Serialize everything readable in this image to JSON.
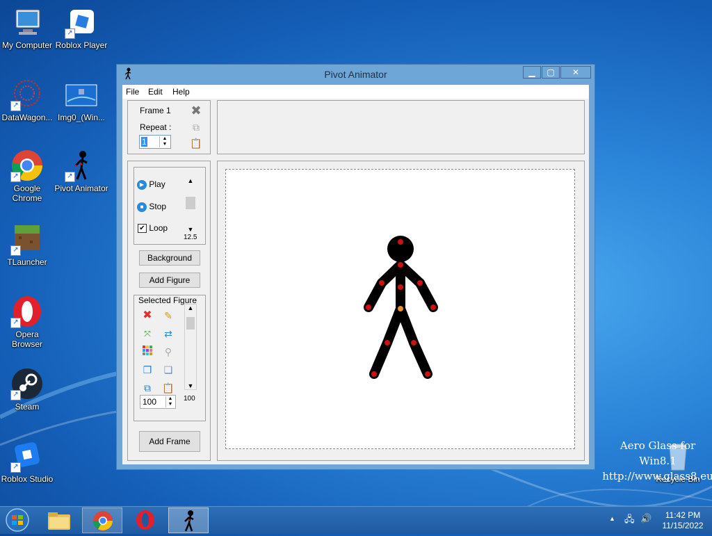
{
  "desktop": {
    "icons": [
      {
        "label": "My Computer"
      },
      {
        "label": "Roblox Player"
      },
      {
        "label": "DataWagon..."
      },
      {
        "label": "Img0_(Win..."
      },
      {
        "label": "Google Chrome"
      },
      {
        "label": "Pivot Animator"
      },
      {
        "label": "TLauncher"
      },
      {
        "label": "Opera Browser"
      },
      {
        "label": "Steam"
      },
      {
        "label": "Roblox Studio"
      },
      {
        "label": "Recycle Bin"
      }
    ],
    "watermark_line1": "Aero Glass for Win8.1",
    "watermark_line2": "http://www.glass8.eu"
  },
  "window": {
    "title": "Pivot Animator",
    "menu": [
      "File",
      "Edit",
      "Help"
    ],
    "frame_panel": {
      "frame_label": "Frame 1",
      "repeat_label": "Repeat :",
      "repeat_value": "1"
    },
    "playback": {
      "play": "Play",
      "stop": "Stop",
      "loop": "Loop",
      "loop_checked": true,
      "speed": "12.5"
    },
    "background_button": "Background",
    "add_figure_button": "Add Figure",
    "selected_figure": {
      "title": "Selected Figure",
      "size_value": "100",
      "scroll_value": "100"
    },
    "add_frame_button": "Add Frame"
  },
  "taskbar": {
    "time": "11:42 PM",
    "date": "11/15/2022",
    "items": [
      "start-orb",
      "file-explorer",
      "google-chrome",
      "opera",
      "pivot-animator"
    ]
  },
  "colors": {
    "joint_red": "#cc1111",
    "joint_orange": "#e8932a",
    "figure": "#000000"
  }
}
